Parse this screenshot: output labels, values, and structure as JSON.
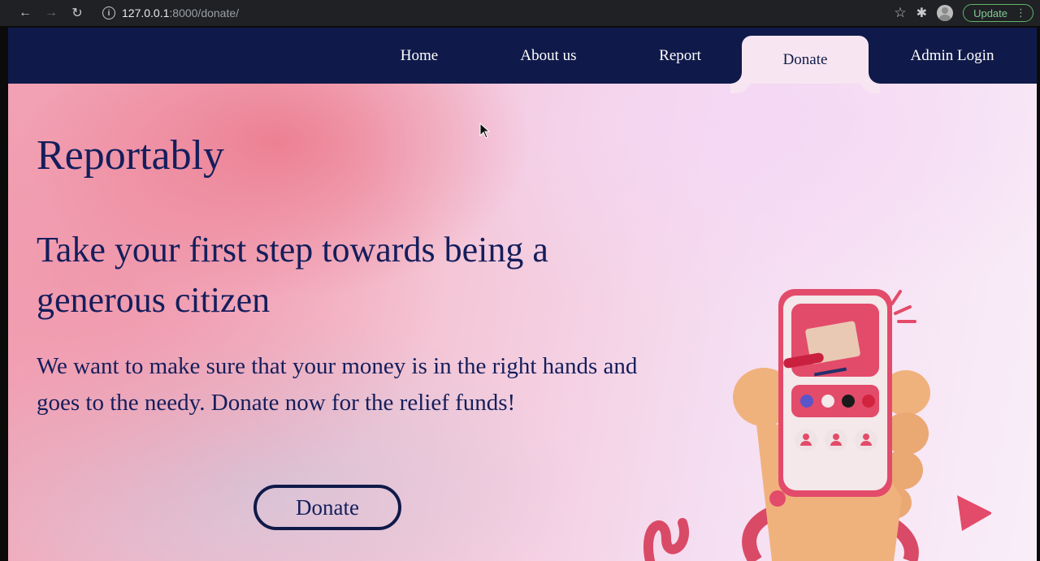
{
  "browser": {
    "url_host": "127.0.0.1",
    "url_path": ":8000/donate/",
    "update_label": "Update"
  },
  "nav": {
    "items": [
      {
        "label": "Home"
      },
      {
        "label": "About us"
      },
      {
        "label": "Report"
      },
      {
        "label": "Donate",
        "active": true
      },
      {
        "label": "Admin Login"
      }
    ]
  },
  "hero": {
    "brand": "Reportably",
    "headline": "Take your first step towards being a generous citizen",
    "lead": "We want to make sure that your money is in the right hands and goes to the needy. Donate now for the relief funds!",
    "button_label": "Donate"
  },
  "colors": {
    "navbar": "#101a4a",
    "text": "#141e5c",
    "accent_pink": "#e34b6a"
  }
}
